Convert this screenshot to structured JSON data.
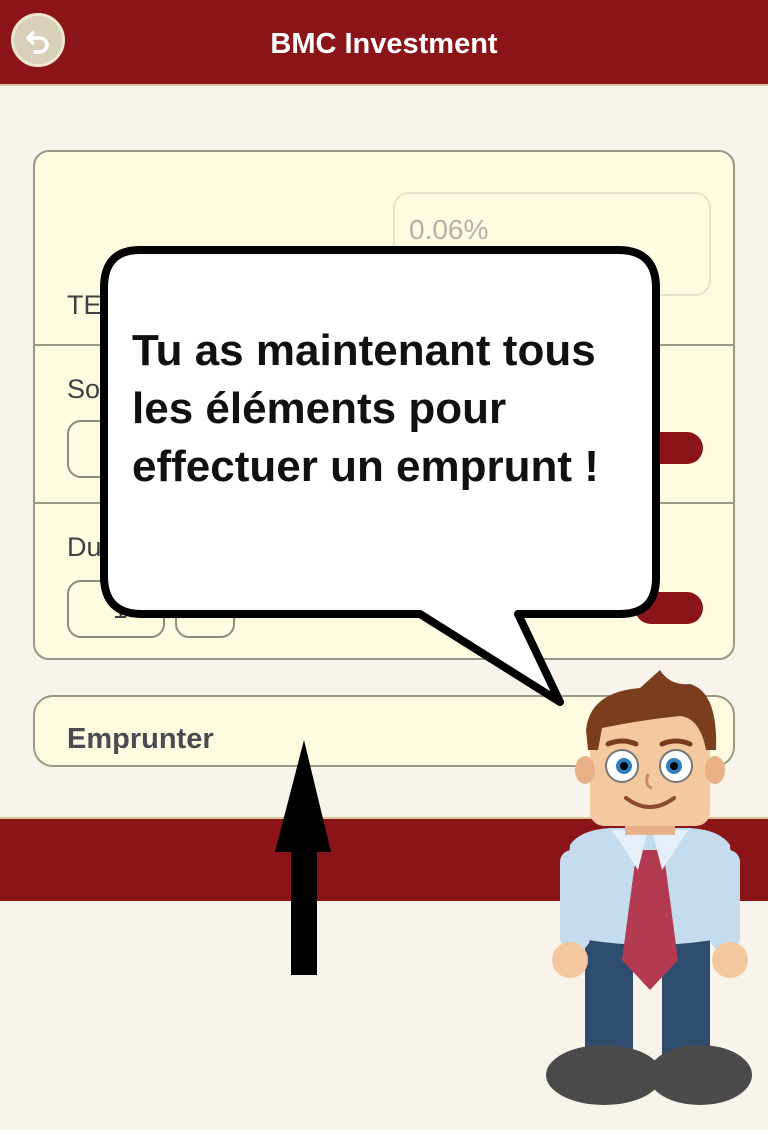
{
  "header": {
    "title": "BMC Investment",
    "back_icon": "back-arrow-icon",
    "background": "#8b1418"
  },
  "form": {
    "rate_value": "0.06%",
    "rate_label_partial": "TE",
    "amount_label_partial": "So",
    "duration_label_partial": "Du",
    "duration_value_partial": "1"
  },
  "actions": {
    "borrow_label": "Emprunter"
  },
  "tutorial": {
    "bubble_text": "Tu as maintenant tous les éléments pour effectuer un emprunt !"
  },
  "colors": {
    "accent": "#8b1418",
    "card": "#fffbe0",
    "page": "#f8f4eb"
  }
}
